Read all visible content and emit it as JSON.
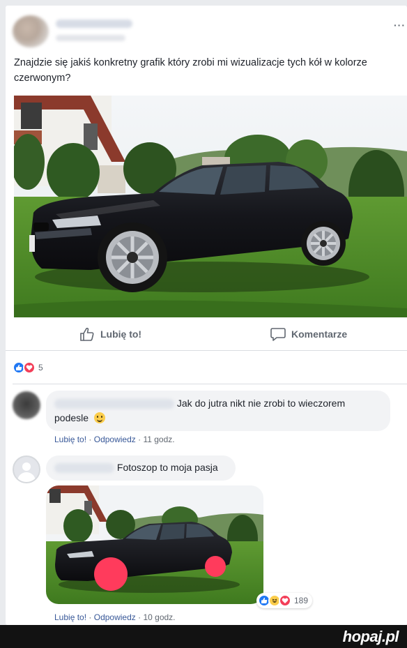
{
  "post": {
    "text": "Znajdzie się jakiś konkretny grafik który zrobi mi wizualizacje tych kół w kolorze czerwonym?",
    "menu_icon": "more-icon",
    "actions": {
      "like_label": "Lubię to!",
      "comment_label": "Komentarze"
    },
    "reactions": {
      "icons": [
        "like-icon",
        "love-icon"
      ],
      "count": "5"
    }
  },
  "comments": [
    {
      "text": "Jak do jutra nikt nie zrobi to wieczorem podesle",
      "emoji": "smile-emoji",
      "like_label": "Lubię to!",
      "separator": "·",
      "reply_label": "Odpowiedz",
      "time": "11 godz."
    },
    {
      "text": "Fotoszop to moja pasja",
      "like_label": "Lubię to!",
      "separator": "·",
      "reply_label": "Odpowiedz",
      "time": "10 godz.",
      "reactions": {
        "icons": [
          "like-icon",
          "haha-icon",
          "love-icon"
        ],
        "count": "189"
      }
    }
  ],
  "footer": {
    "brand": "hopaj.pl"
  },
  "colors": {
    "link": "#385898",
    "like_blue": "#2078f4",
    "love_red": "#f33e58",
    "haha_yellow": "#fbcd4c",
    "wheel_red": "#ff3b5c"
  }
}
